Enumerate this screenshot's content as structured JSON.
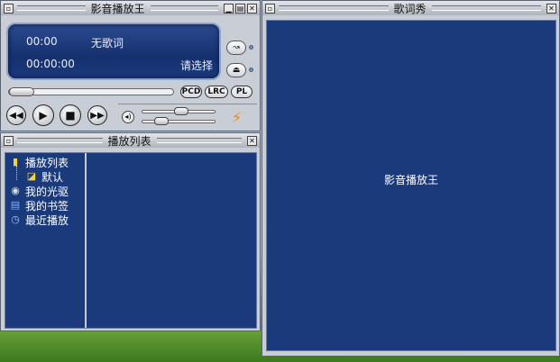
{
  "player": {
    "title": "影音播放王",
    "time_elapsed": "00:00",
    "lyric_status": "无歌词",
    "time_total": "00:00:00",
    "hint": "请选择",
    "btn_pcd": "PCD",
    "btn_lrc": "LRC",
    "btn_pl": "PL",
    "seek_fraction": 0,
    "volume_fraction": 0.55,
    "balance_fraction": 0.2
  },
  "playlist": {
    "title": "播放列表",
    "items": [
      {
        "label": "播放列表",
        "icon": "folder-icon"
      },
      {
        "label": "默认",
        "icon": "open-folder-icon"
      },
      {
        "label": "我的光驱",
        "icon": "cd-drive-icon"
      },
      {
        "label": "我的书签",
        "icon": "bookmark-icon"
      },
      {
        "label": "最近播放",
        "icon": "recent-icon"
      }
    ]
  },
  "lyrics": {
    "title": "歌词秀",
    "text": "影音播放王"
  },
  "colors": {
    "panel_blue": "#1b3a7c",
    "frame_gray": "#c8cdd6",
    "accent_orange": "#f08a00"
  }
}
